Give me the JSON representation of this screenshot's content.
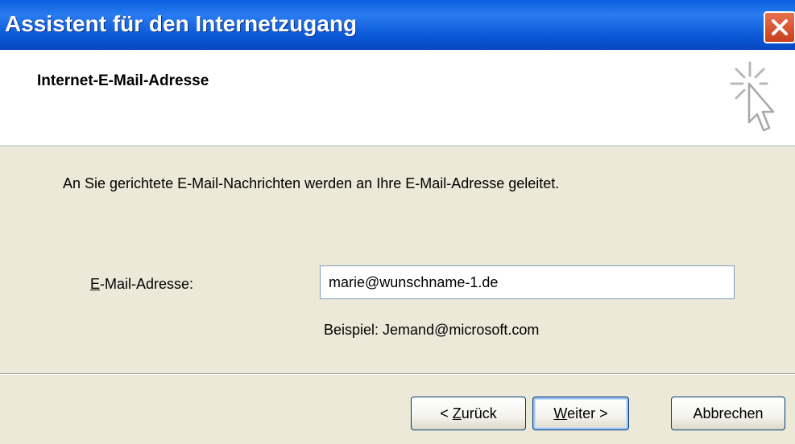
{
  "window": {
    "title": "Assistent für den Internetzugang",
    "close_icon": "close-icon"
  },
  "header": {
    "title": "Internet-E-Mail-Adresse",
    "icon": "sparkle-cursor-icon"
  },
  "main": {
    "description": "An Sie gerichtete E-Mail-Nachrichten werden an Ihre E-Mail-Adresse geleitet.",
    "email_label_mnemonic": "E",
    "email_label_rest": "-Mail-Adresse:",
    "email_value": "marie@wunschname-1.de",
    "example": "Beispiel: Jemand@microsoft.com"
  },
  "buttons": {
    "back_prefix": "< ",
    "back_mnemonic": "Z",
    "back_rest": "urück",
    "next_mnemonic": "W",
    "next_rest": "eiter >",
    "cancel": "Abbrechen"
  },
  "colors": {
    "titlebar": "#0a5fe0",
    "close": "#d8552e",
    "dialog_bg": "#ece9d8"
  }
}
